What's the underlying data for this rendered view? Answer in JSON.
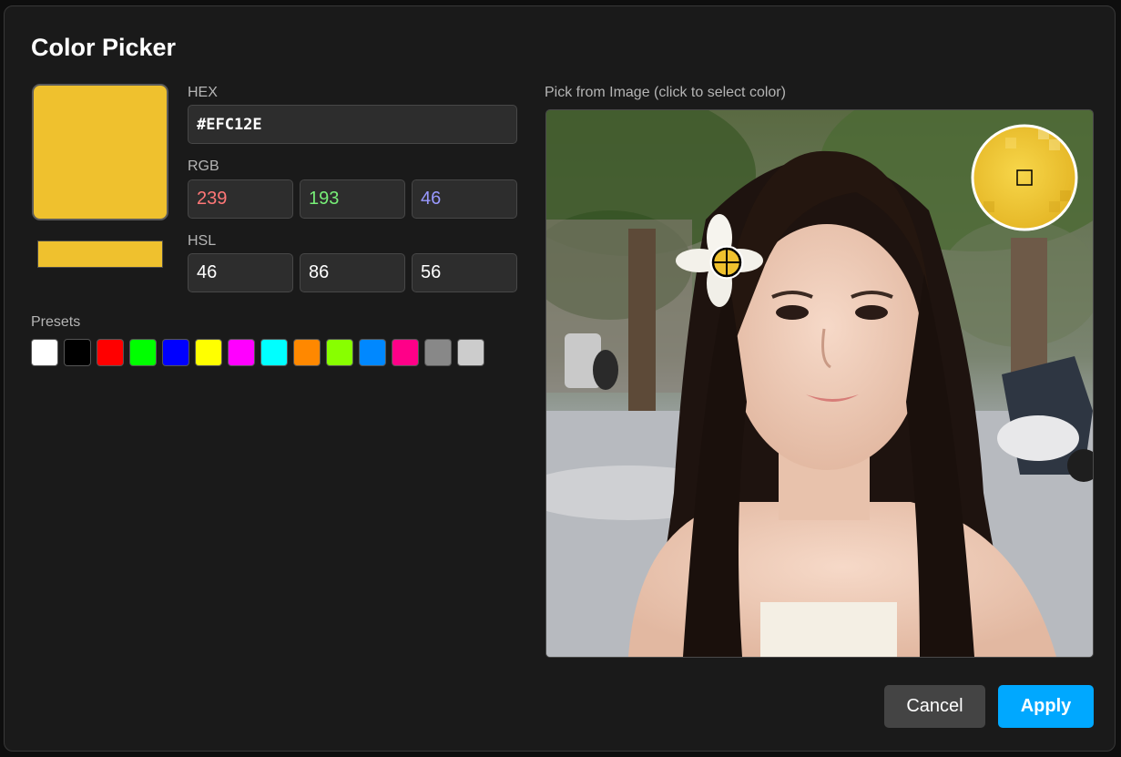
{
  "dialog": {
    "title": "Color Picker"
  },
  "current_color": "#EFC12E",
  "hex": {
    "label": "HEX",
    "value": "#EFC12E"
  },
  "rgb": {
    "label": "RGB",
    "r": "239",
    "g": "193",
    "b": "46",
    "r_color": "#ff7777",
    "g_color": "#77ee77",
    "b_color": "#9999ff"
  },
  "hsl": {
    "label": "HSL",
    "h": "46",
    "s": "86",
    "l": "56"
  },
  "presets": {
    "label": "Presets",
    "colors": [
      "#FFFFFF",
      "#000000",
      "#FF0000",
      "#00FF00",
      "#0000FF",
      "#FFFF00",
      "#FF00FF",
      "#00FFFF",
      "#FF8800",
      "#88FF00",
      "#0088FF",
      "#FF0088",
      "#888888",
      "#CCCCCC"
    ]
  },
  "image_picker": {
    "label": "Pick from Image (click to select color)",
    "icons": [
      "crosshair-icon",
      "magnifier-loupe"
    ]
  },
  "actions": {
    "cancel": "Cancel",
    "apply": "Apply",
    "apply_color": "#00A8FF"
  }
}
